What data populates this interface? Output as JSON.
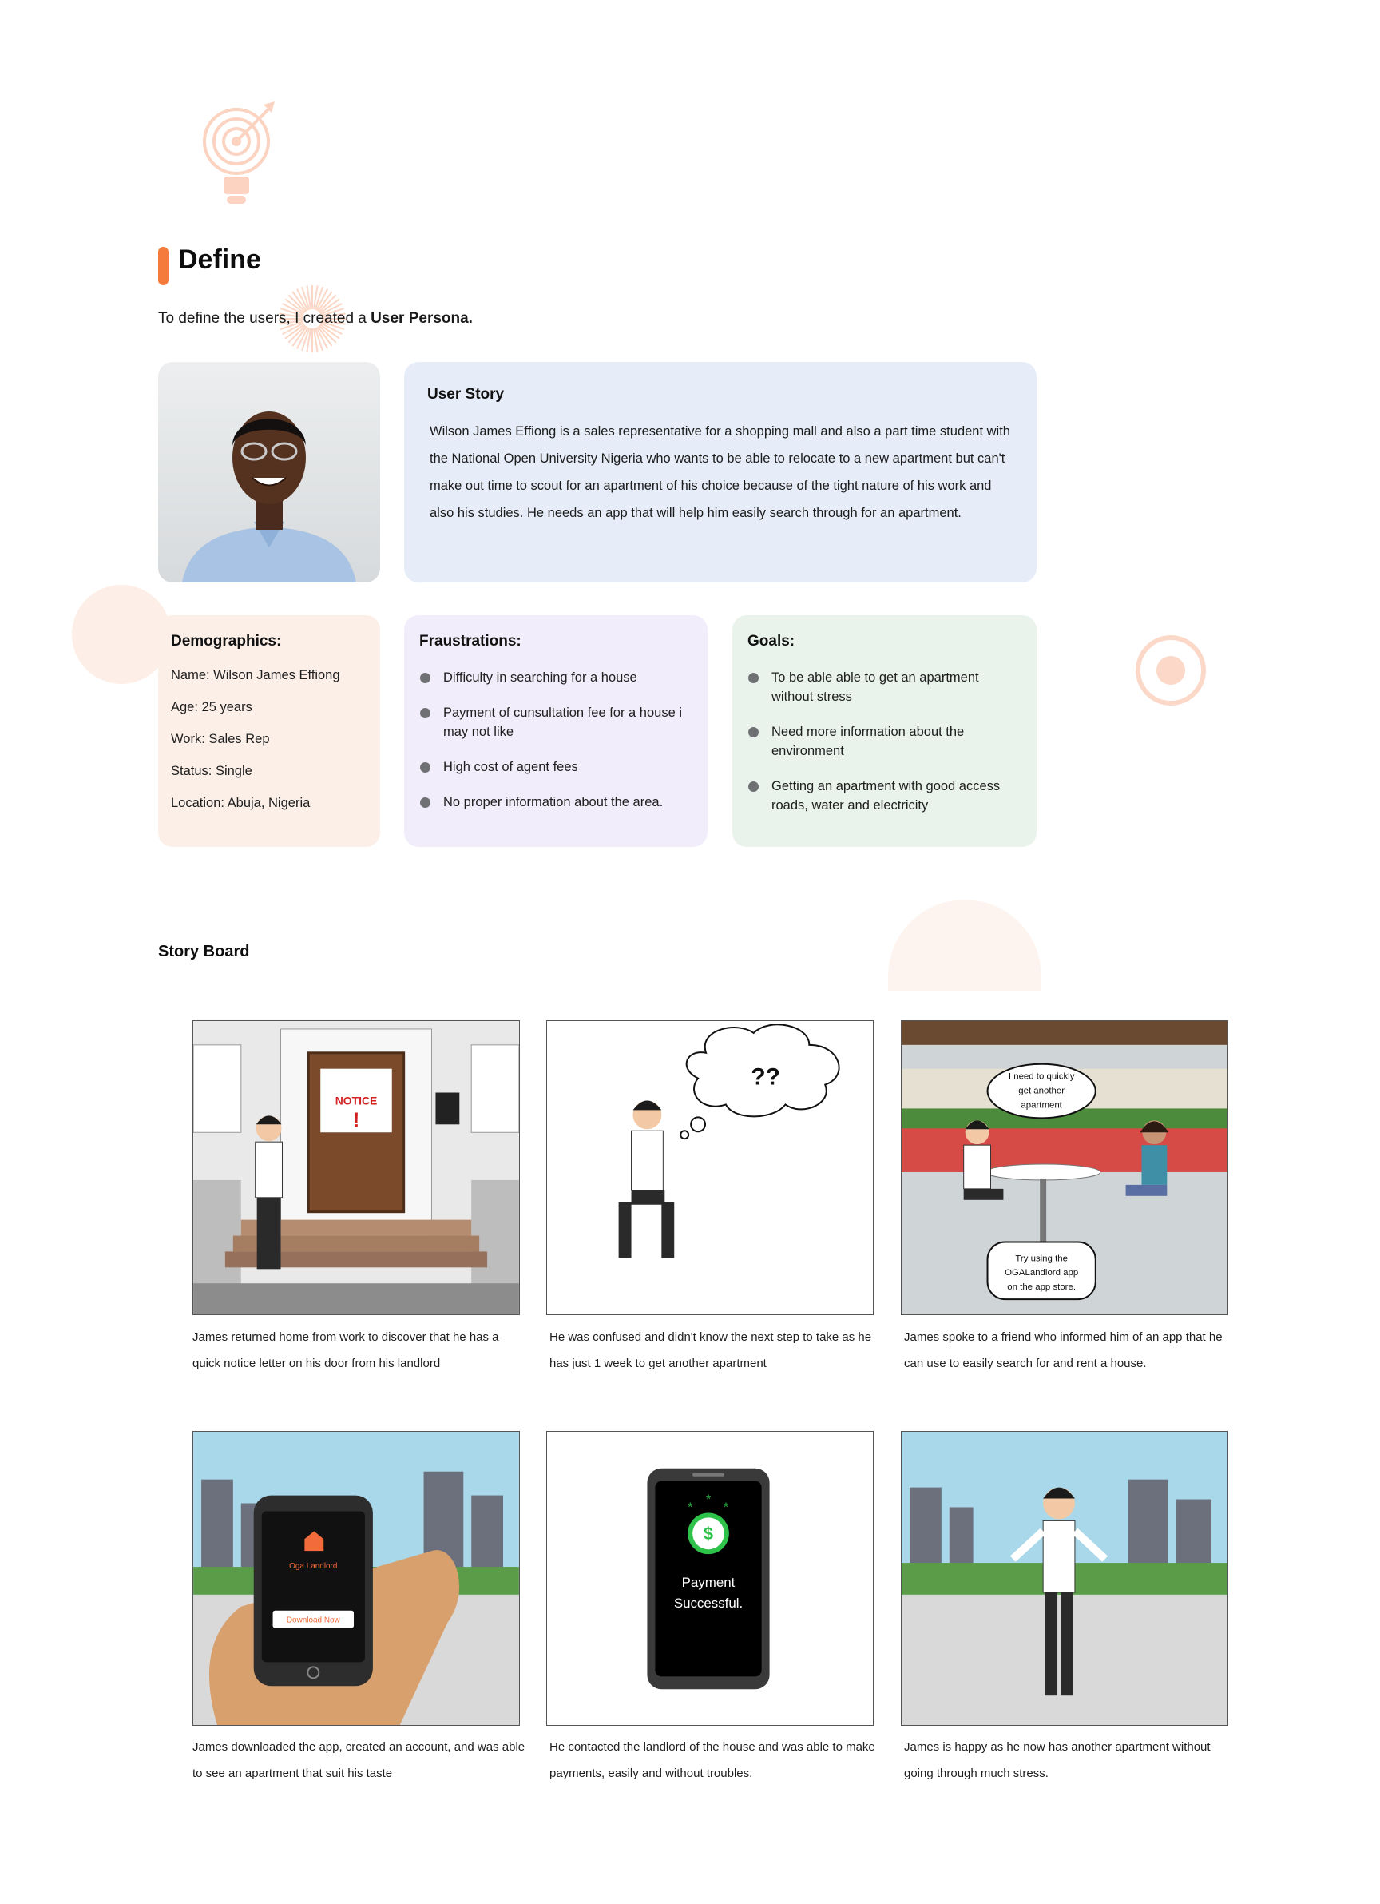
{
  "define": {
    "title": "Define",
    "intro_prefix": "To define the users, I created a ",
    "intro_bold": "User Persona."
  },
  "user_story": {
    "heading": "User Story",
    "body": "Wilson James Effiong is a sales representative for a shopping mall and also a part time student with the National Open University Nigeria who wants to be able to relocate to a new apartment but can't make out time to scout for an apartment of his choice because of the tight nature of his work and also his studies. He needs an app that will help him easily search through for an apartment."
  },
  "demographics": {
    "heading": "Demographics:",
    "lines": [
      "Name: Wilson James Effiong",
      "Age: 25 years",
      "Work: Sales Rep",
      "Status: Single",
      "Location: Abuja, Nigeria"
    ]
  },
  "frustrations": {
    "heading": "Fraustrations:",
    "items": [
      "Difficulty in searching for a house",
      "Payment of cunsultation fee for a house i may not like",
      "High cost of agent fees",
      "No proper information about the area."
    ]
  },
  "goals": {
    "heading": "Goals:",
    "items": [
      "To be able able to get an apartment without stress",
      "Need more information about the environment",
      "Getting an apartment with good access roads, water and electricity"
    ]
  },
  "storyboard": {
    "title": "Story Board",
    "panels": [
      {
        "caption": "James returned home from work to discover that he has a quick notice letter on his door from his landlord",
        "notice_text": "NOTICE",
        "notice_mark": "!"
      },
      {
        "caption": "He was confused and didn't know the next step to take as he has just 1 week to get another apartment",
        "thought_text": "??"
      },
      {
        "caption": "James spoke to a friend who informed him of an app that he can use to easily search for and rent a house.",
        "bubble_1": [
          "I need to quickly",
          "get another",
          "apartment"
        ],
        "bubble_2": [
          "Try using the",
          "OGALandlord app",
          "on the app store."
        ]
      },
      {
        "caption": "James downloaded the app, created an account, and was able to see an apartment that suit his taste",
        "app_name": "Oga Landlord",
        "button_text": "Download Now"
      },
      {
        "caption": "He contacted the landlord of the house and was able to make payments, easily and without troubles.",
        "symbol": "$",
        "status_lines": [
          "Payment",
          "Successful."
        ]
      },
      {
        "caption": "James is happy as he now has another apartment without going through much stress."
      }
    ]
  },
  "colors": {
    "accent": "#f47b3c",
    "story_bg": "#e6edf8",
    "demo_bg": "#fcefe8",
    "fr_bg": "#f1edfa",
    "goal_bg": "#e9f3ec"
  }
}
